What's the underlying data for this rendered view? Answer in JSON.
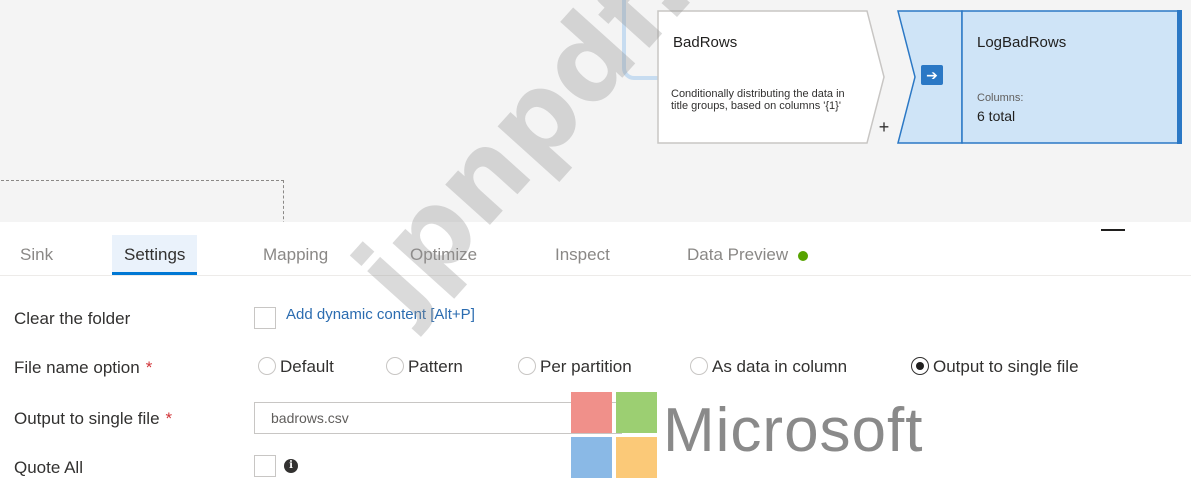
{
  "canvas": {
    "badrows_node": {
      "title": "BadRows",
      "description": "Conditionally distributing the data in title groups, based on columns '{1}'"
    },
    "add_button": "+",
    "sink_node": {
      "title": "LogBadRows",
      "columns_label": "Columns:",
      "columns_value": "6 total",
      "icon": "sink-arrow-icon"
    }
  },
  "tabs": [
    {
      "label": "Sink"
    },
    {
      "label": "Settings"
    },
    {
      "label": "Mapping"
    },
    {
      "label": "Optimize"
    },
    {
      "label": "Inspect"
    },
    {
      "label": "Data Preview"
    }
  ],
  "active_tab": "Settings",
  "form": {
    "clear_folder": {
      "label": "Clear the folder",
      "link": "Add dynamic content [Alt+P]"
    },
    "file_name_option": {
      "label": "File name option",
      "required_mark": "*",
      "options": [
        "Default",
        "Pattern",
        "Per partition",
        "As data in column",
        "Output to single file"
      ],
      "selected": "Output to single file"
    },
    "output_single_file": {
      "label": "Output to single file",
      "required_mark": "*",
      "value": "badrows.csv"
    },
    "quote_all": {
      "label": "Quote All"
    }
  },
  "watermark": {
    "text": "jpnpdf.com",
    "brand": "Microsoft"
  },
  "colors": {
    "accent": "#0078d4",
    "status_green": "#57a300",
    "node_selected_bg": "#cfe4f7"
  }
}
